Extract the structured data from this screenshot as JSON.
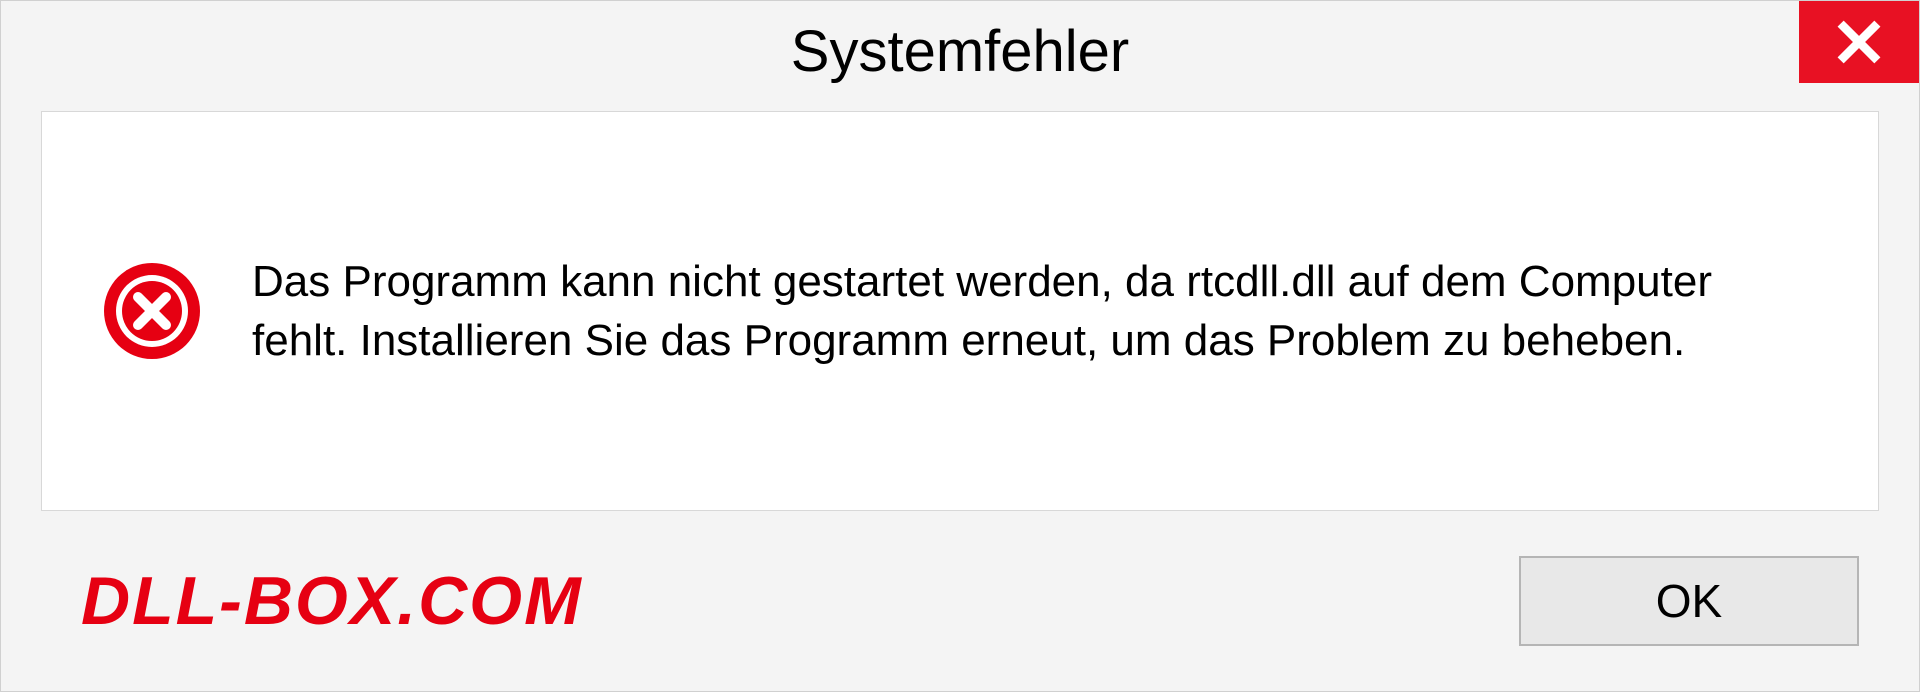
{
  "dialog": {
    "title": "Systemfehler",
    "message": "Das Programm kann nicht gestartet werden, da rtcdll.dll auf dem Computer fehlt. Installieren Sie das Programm erneut, um das Problem zu beheben.",
    "ok_label": "OK"
  },
  "watermark": "DLL-BOX.COM",
  "icons": {
    "close": "close-icon",
    "error": "error-icon"
  },
  "colors": {
    "close_bg": "#e81123",
    "error_red": "#e60012",
    "watermark_red": "#e60012",
    "dialog_bg": "#f4f4f4",
    "panel_bg": "#ffffff"
  }
}
